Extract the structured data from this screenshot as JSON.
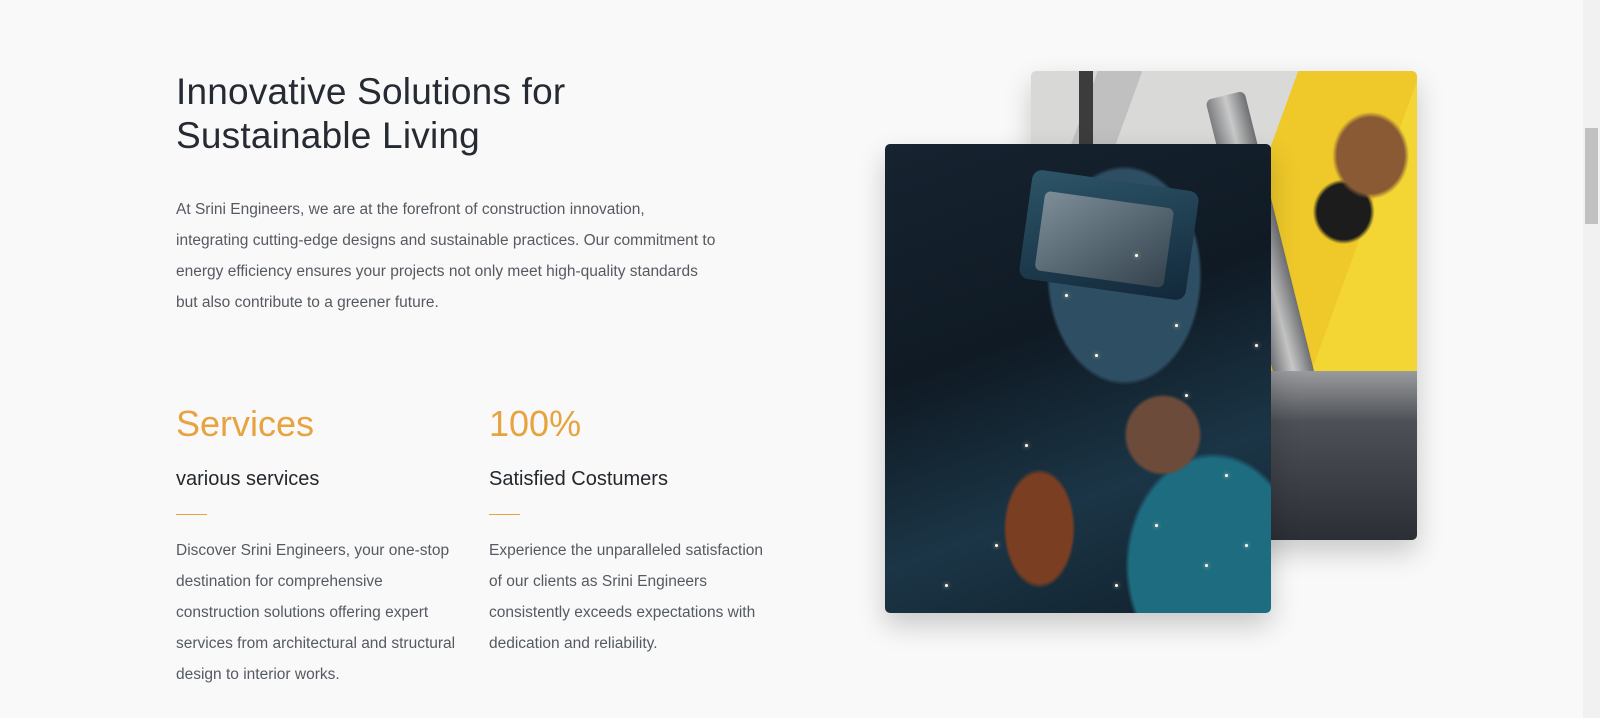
{
  "hero": {
    "title_line1": "Innovative Solutions for",
    "title_line2": "Sustainable Living",
    "intro": "At Srini Engineers, we are at the forefront of construction innovation, integrating cutting-edge designs and sustainable practices. Our commitment to energy efficiency ensures your projects not only meet high-quality standards but also contribute to a greener future."
  },
  "stats": [
    {
      "value": "Services",
      "title": "various services",
      "text": "Discover Srini Engineers, your one-stop destination for comprehensive construction solutions offering expert services from architectural and structural design to interior works."
    },
    {
      "value": "100%",
      "title": "Satisfied Costumers",
      "text": "Experience the unparalleled satisfaction of our clients as Srini Engineers consistently exceeds expectations with dedication and reliability."
    }
  ],
  "colors": {
    "accent": "#e7a33f",
    "heading": "#262b33",
    "body": "#555a61",
    "background": "#f9f9f9"
  }
}
